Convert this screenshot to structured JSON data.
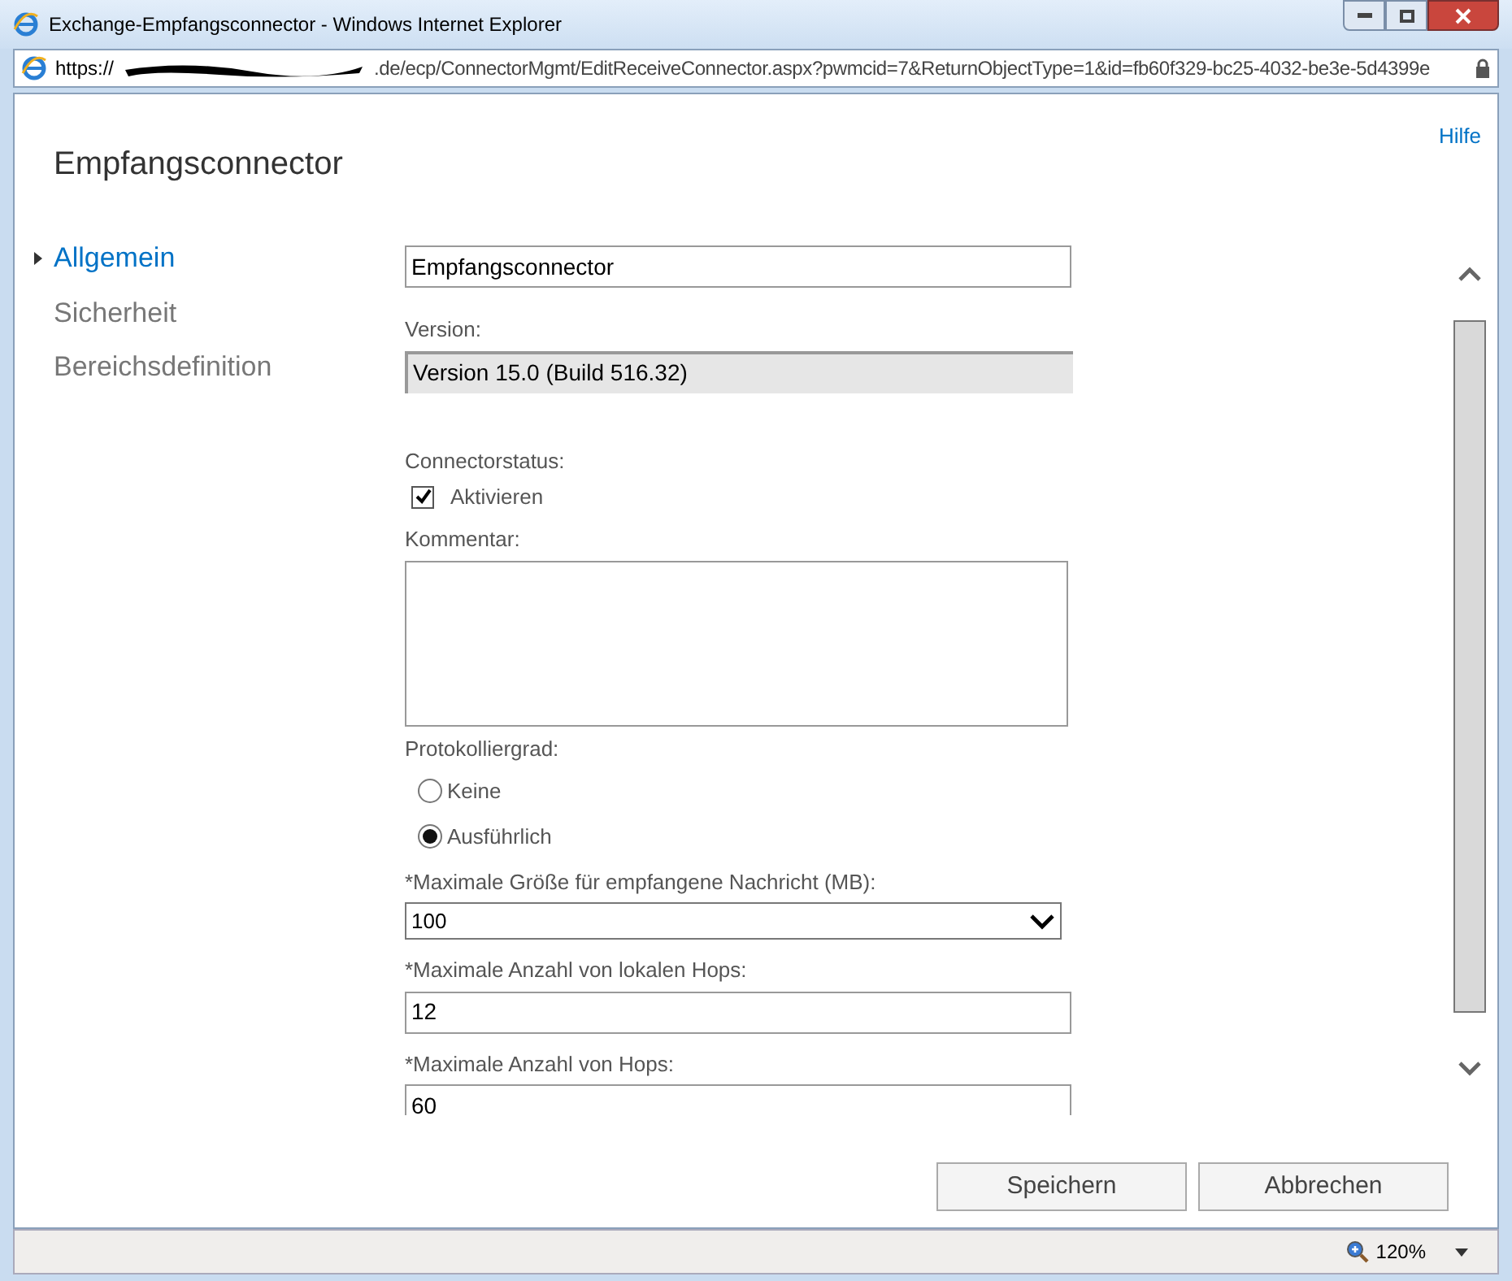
{
  "window": {
    "title": "Exchange-Empfangsconnector - Windows Internet Explorer"
  },
  "address_bar": {
    "prefix": "https://",
    "url": ".de/ecp/ConnectorMgmt/EditReceiveConnector.aspx?pwmcid=7&ReturnObjectType=1&id=fb60f329-bc25-4032-be3e-5d4399e"
  },
  "page": {
    "title": "Empfangsconnector",
    "help": "Hilfe"
  },
  "nav": [
    {
      "label": "Allgemein",
      "selected": true
    },
    {
      "label": "Sicherheit",
      "selected": false
    },
    {
      "label": "Bereichsdefinition",
      "selected": false
    }
  ],
  "form": [
    {
      "kind": "text",
      "value": "Empfangsconnector"
    },
    {
      "kind": "readonly",
      "label": "Version:",
      "value": "Version 15.0 (Build 516.32)"
    },
    {
      "kind": "checkbox",
      "label": "Connectorstatus:",
      "option": "Aktivieren",
      "checked": true
    },
    {
      "kind": "textarea",
      "label": "Kommentar:"
    },
    {
      "kind": "radio",
      "label": "Protokolliergrad:",
      "options": [
        {
          "label": "Keine",
          "selected": false
        },
        {
          "label": "Ausführlich",
          "selected": true
        }
      ]
    },
    {
      "kind": "select",
      "label": "*Maximale Größe für empfangene Nachricht (MB):",
      "value": "100"
    },
    {
      "kind": "text",
      "label": "*Maximale Anzahl von lokalen Hops:",
      "value": "12"
    },
    {
      "kind": "text",
      "label": "*Maximale Anzahl von Hops:",
      "value": "60"
    }
  ],
  "buttons": [
    "Speichern",
    "Abbrechen"
  ],
  "status_bar": {
    "zoom": "120%"
  }
}
